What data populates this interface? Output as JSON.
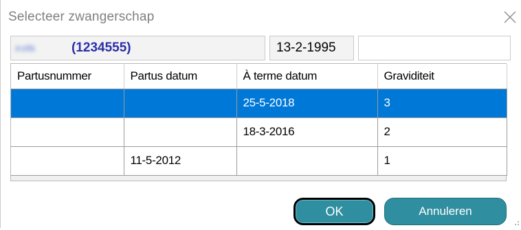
{
  "window": {
    "title": "Selecteer zwangerschap"
  },
  "patient": {
    "name": "iroltk",
    "id": "(1234555)",
    "birthdate": "13-2-1995",
    "extra": ""
  },
  "grid": {
    "columns": [
      "Partusnummer",
      "Partus datum",
      "À terme datum",
      "Graviditeit"
    ],
    "rows": [
      {
        "partusnummer": "",
        "partus_datum": "",
        "aterme_datum": "25-5-2018",
        "graviditeit": "3",
        "selected": true
      },
      {
        "partusnummer": "",
        "partus_datum": "",
        "aterme_datum": "18-3-2016",
        "graviditeit": "2",
        "selected": false
      },
      {
        "partusnummer": "",
        "partus_datum": "11-5-2012",
        "aterme_datum": "",
        "graviditeit": "1",
        "selected": false
      }
    ]
  },
  "buttons": {
    "ok_label": "OK",
    "cancel_label": "Annuleren"
  },
  "colors": {
    "selection": "#0078d7",
    "button": "#2f8e9f",
    "patient_id": "#2b2fa8"
  },
  "icons": {
    "close": "close-icon",
    "resize": "resize-grip-icon"
  }
}
